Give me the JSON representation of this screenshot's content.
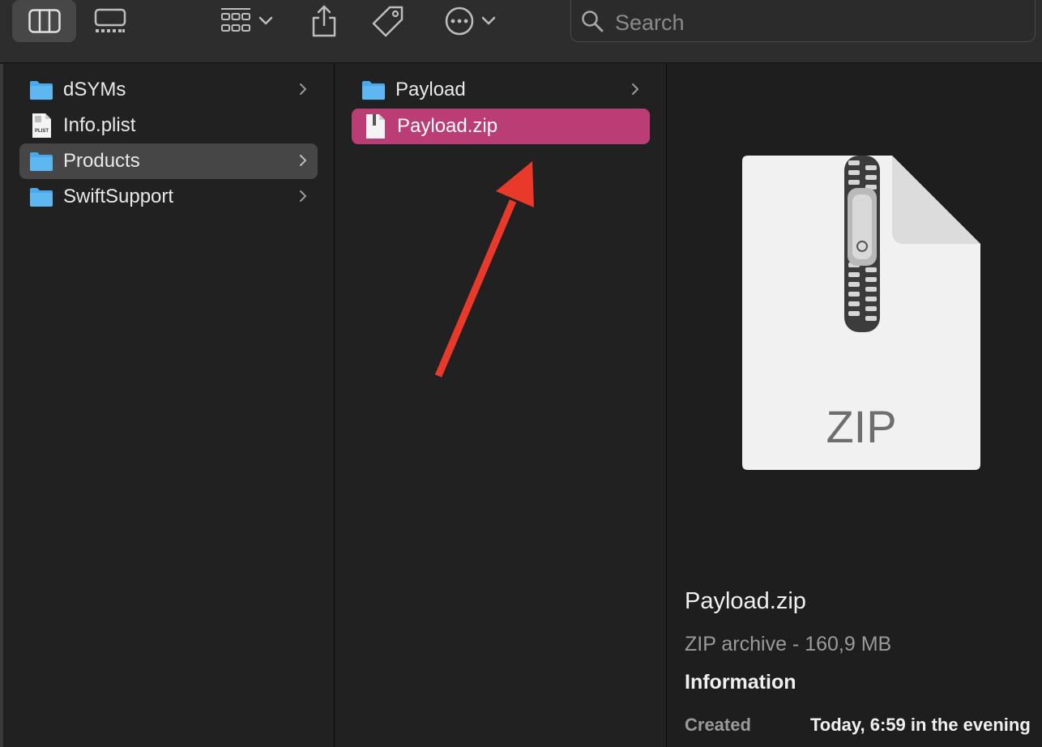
{
  "toolbar": {
    "search": {
      "placeholder": "Search"
    },
    "buttons": [
      {
        "name": "column-view",
        "icon": "column-view-icon",
        "active": true
      },
      {
        "name": "gallery-view",
        "icon": "gallery-view-icon"
      },
      {
        "name": "group",
        "icon": "grid-group-icon"
      },
      {
        "name": "share",
        "icon": "share-icon"
      },
      {
        "name": "tags",
        "icon": "tag-icon"
      },
      {
        "name": "more-actions",
        "icon": "ellipsis-circle-icon"
      }
    ]
  },
  "column1": {
    "items": [
      {
        "label": "dSYMs",
        "icon": "folder-icon",
        "has_children": true
      },
      {
        "label": "Info.plist",
        "icon": "plist-file-icon",
        "badge": "PLIST",
        "has_children": false
      },
      {
        "label": "Products",
        "icon": "folder-icon",
        "has_children": true,
        "selected": true
      },
      {
        "label": "SwiftSupport",
        "icon": "folder-icon",
        "has_children": true
      }
    ]
  },
  "column2": {
    "items": [
      {
        "label": "Payload",
        "icon": "folder-icon",
        "has_children": true
      },
      {
        "label": "Payload.zip",
        "icon": "zip-file-icon",
        "has_children": false,
        "selected": true
      }
    ]
  },
  "preview": {
    "big_icon_label": "ZIP",
    "name": "Payload.zip",
    "kind": "ZIP archive - 160,9 MB",
    "info_heading": "Information",
    "created_label": "Created",
    "created_value": "Today, 6:59 in the evening"
  },
  "colors": {
    "selection_pink": "#bb3d76",
    "selection_gray": "#464646",
    "annotation_arrow": "#e8392b",
    "folder_blue": "#4aa8ec"
  }
}
